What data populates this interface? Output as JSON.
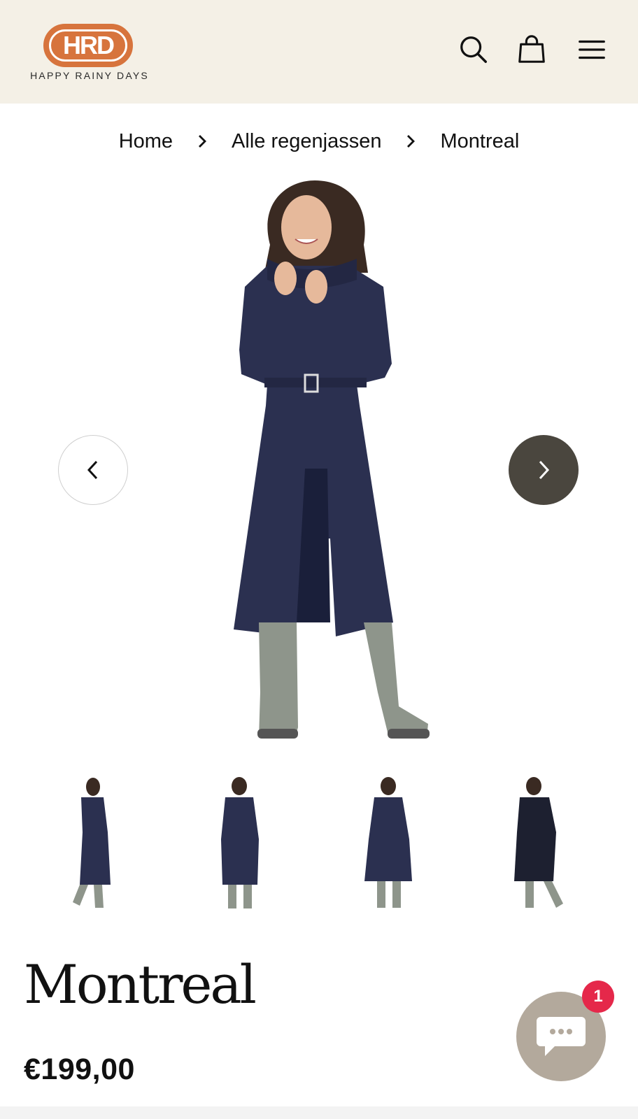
{
  "brand": {
    "logo_letters": "HRD",
    "name": "HAPPY RAINY DAYS",
    "accent_color": "#d7743d"
  },
  "header": {
    "background": "#f4f0e6",
    "icons": [
      "search-icon",
      "cart-icon",
      "menu-icon"
    ]
  },
  "breadcrumb": [
    {
      "label": "Home"
    },
    {
      "label": "Alle regenjassen"
    },
    {
      "label": "Montreal"
    }
  ],
  "gallery": {
    "prev_icon": "chevron-left-icon",
    "next_icon": "chevron-right-icon",
    "next_color": "#4a463e"
  },
  "product": {
    "title": "Montreal",
    "price": "€199,00",
    "coat_color": "#2b3050"
  },
  "chat": {
    "icon": "chat-bubble-icon",
    "badge_count": "1",
    "badge_color": "#e5284a"
  }
}
